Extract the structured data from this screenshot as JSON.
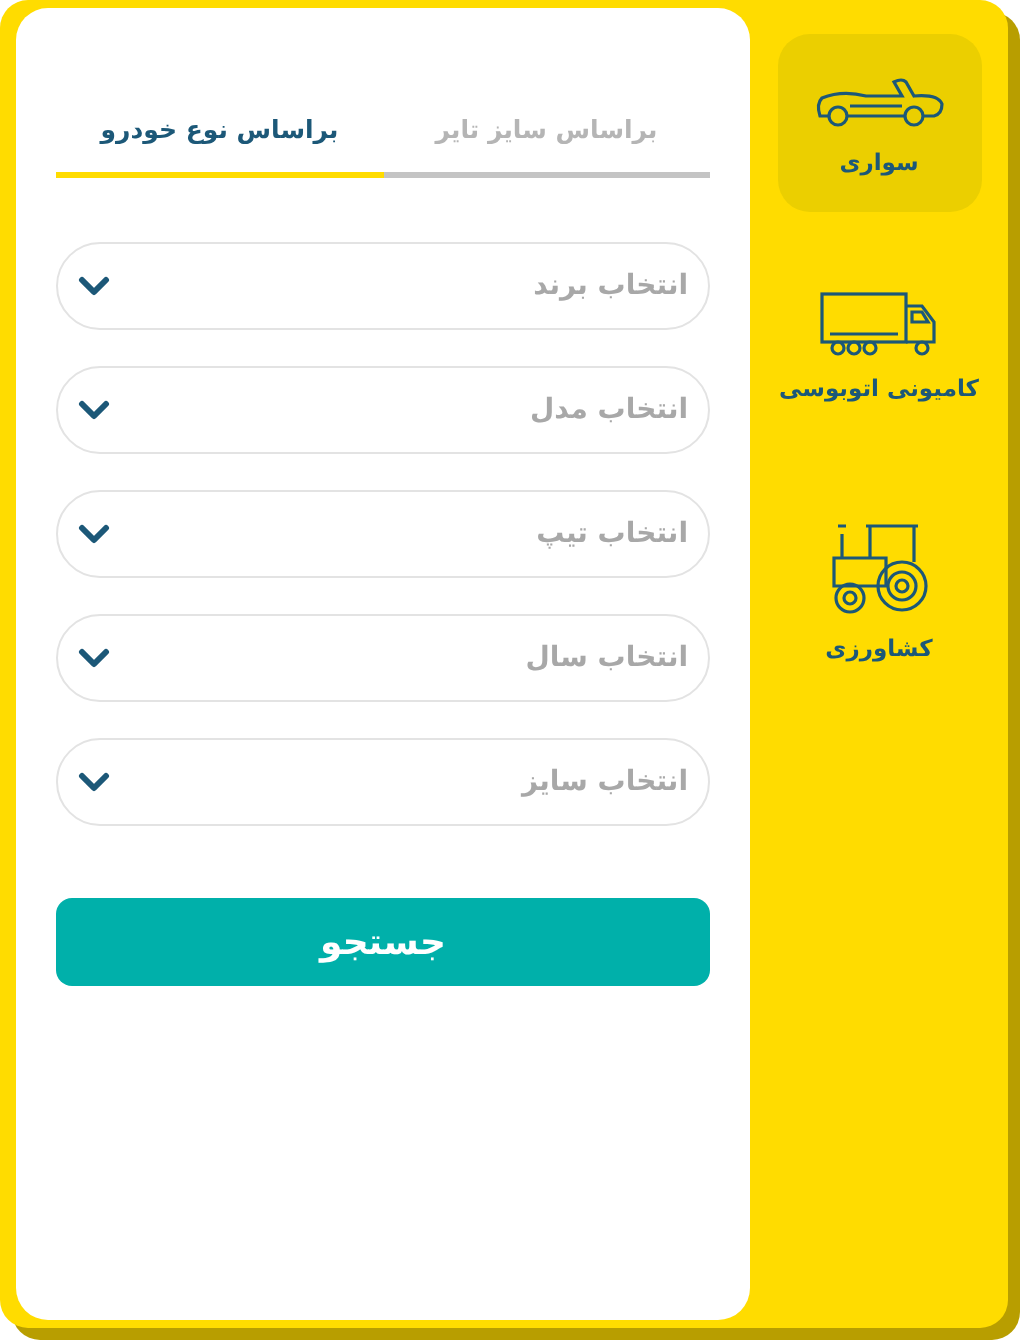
{
  "categories": [
    {
      "label": "سواری",
      "kind": "car",
      "selected": true
    },
    {
      "label": "کامیونی اتوبوسی",
      "kind": "truck",
      "selected": false
    },
    {
      "label": "کشاورزی",
      "kind": "tractor",
      "selected": false
    }
  ],
  "tabs": [
    {
      "label": "براساس سایز تایر",
      "selected": false
    },
    {
      "label": "براساس نوع خودرو",
      "selected": true
    }
  ],
  "selects": [
    {
      "placeholder": "انتخاب برند"
    },
    {
      "placeholder": "انتخاب مدل"
    },
    {
      "placeholder": "انتخاب تیپ"
    },
    {
      "placeholder": "انتخاب سال"
    },
    {
      "placeholder": "انتخاب سایز"
    }
  ],
  "search_button": {
    "label": "جستجو"
  }
}
